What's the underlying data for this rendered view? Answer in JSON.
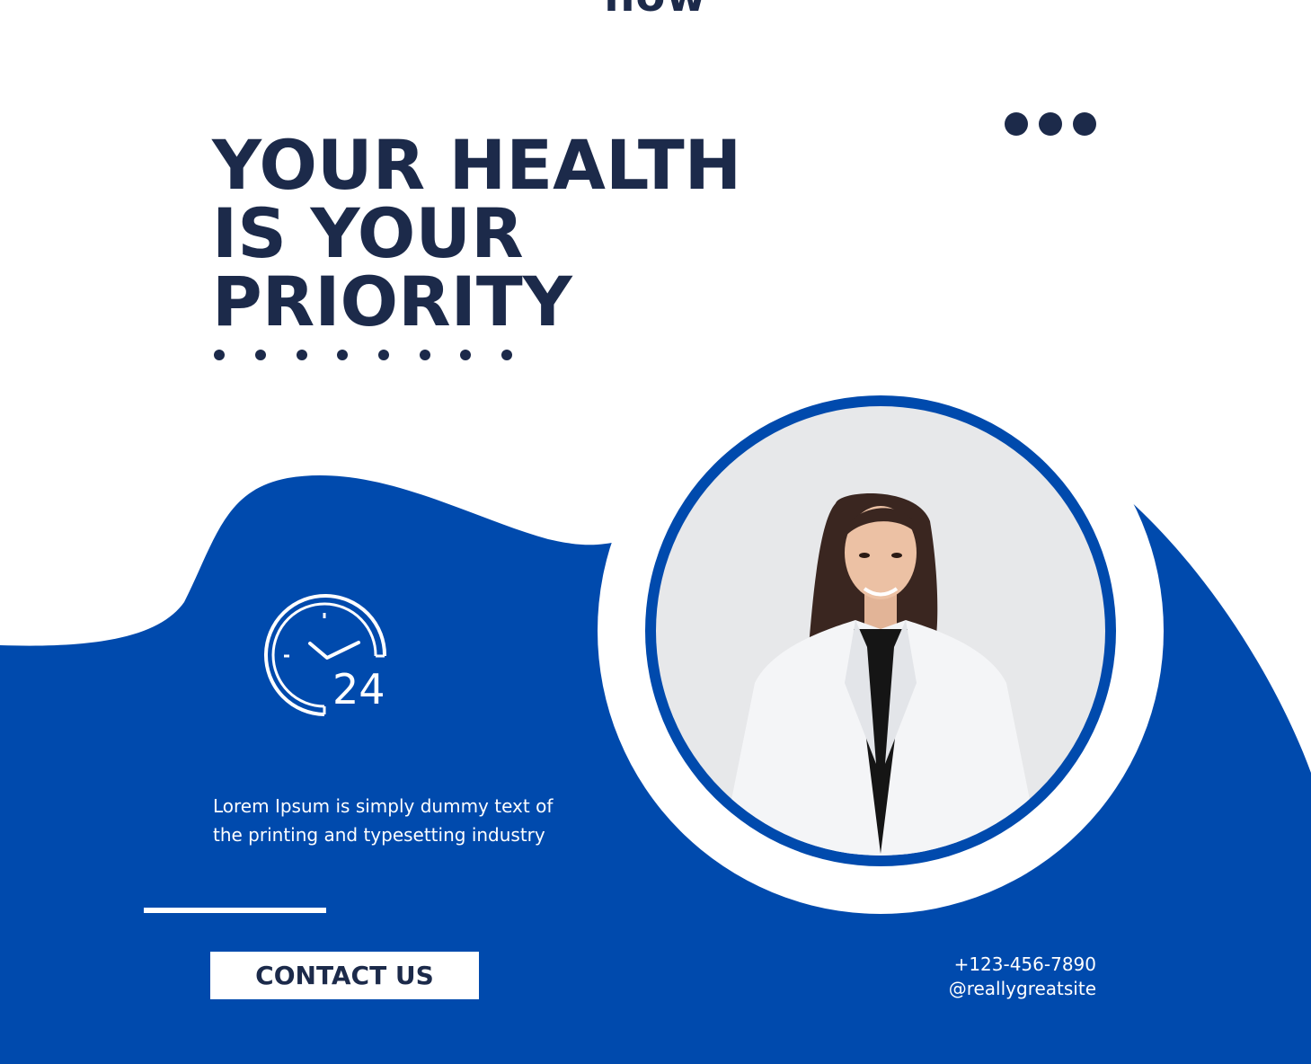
{
  "top_word": "now",
  "headline": {
    "line1": "YOUR HEALTH",
    "line2": "IS YOUR",
    "line3": "PRIORITY"
  },
  "icons": {
    "clock": "clock-24-hours-icon",
    "menu": "more-dots-icon"
  },
  "clock_label": "24",
  "paragraph": "Lorem Ipsum is simply dummy text of the printing and typesetting industry",
  "contact_button": "CONTACT US",
  "contact": {
    "phone": "+123-456-7890",
    "website": "@reallygreatsite"
  },
  "colors": {
    "navy": "#1c2a4a",
    "blue": "#004aad",
    "white": "#ffffff"
  }
}
